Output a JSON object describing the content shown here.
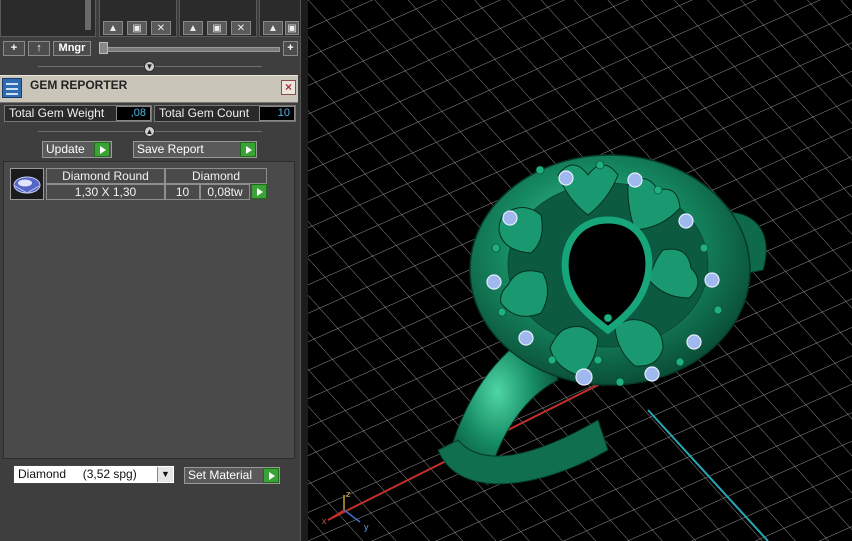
{
  "top_toolbar": {
    "add_label": "+",
    "up_label": "↑",
    "manager_label": "Mngr",
    "slider_plus_label": "+"
  },
  "gem_reporter": {
    "title": "GEM REPORTER",
    "close_label": "×",
    "total_weight_label": "Total Gem Weight",
    "total_weight_value": ",08",
    "total_count_label": "Total Gem Count",
    "total_count_value": "10",
    "update_label": "Update",
    "save_report_label": "Save Report",
    "rows": [
      {
        "shape": "Diamond Round",
        "size": "1,30 X 1,30",
        "material": "Diamond",
        "count": "10",
        "weight": "0,08tw"
      }
    ],
    "material_select_value": "Diamond     (3,52 spg)",
    "set_material_label": "Set Material"
  },
  "viewport": {
    "axis_x": "x",
    "axis_y": "y",
    "axis_z": "z",
    "colors": {
      "background": "#000000",
      "grid": "#9a9a9a",
      "metal": "#137a58",
      "gem": "#9fb8ee",
      "axis_x": "#c0302a",
      "axis_y": "#2aa7b4"
    }
  }
}
